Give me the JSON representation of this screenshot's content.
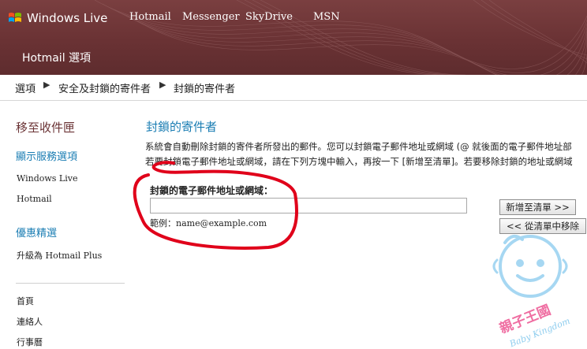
{
  "header": {
    "brand": "Windows Live",
    "nav": [
      "Hotmail",
      "Messenger",
      "SkyDrive",
      "MSN"
    ],
    "page_title": "Hotmail 選項"
  },
  "breadcrumb": [
    "選項",
    "安全及封鎖的寄件者",
    "封鎖的寄件者"
  ],
  "sidebar": {
    "back_link": "移至收件匣",
    "section1_title": "顯示服務選項",
    "section1_items": [
      "Windows Live",
      "Hotmail"
    ],
    "section2_title": "優惠精選",
    "section2_items": [
      "升級為 Hotmail Plus"
    ],
    "bottom_items": [
      "首頁",
      "連絡人",
      "行事曆"
    ]
  },
  "main": {
    "title": "封鎖的寄件者",
    "desc_line1": "系統會自動刪除封鎖的寄件者所發出的郵件。您可以封鎖電子郵件地址或網域 (@ 就後面的電子郵件地址部",
    "desc_line2": "若要封鎖電子郵件地址或網域，請在下列方塊中輸入，再按一下 [新增至清單]。若要移除封鎖的地址或網域",
    "field_label": "封鎖的電子郵件地址或網域：",
    "field_value": "",
    "example": "範例：name@example.com",
    "add_button": "新增至清單 >>",
    "remove_button": "<< 從清單中移除"
  },
  "watermark": {
    "text_cn": "親子王國",
    "text_en": "Baby Kingdom"
  },
  "colors": {
    "header_bg": "#6a3234",
    "link_blue": "#1a7db3",
    "annotation_red": "#e0001a"
  }
}
